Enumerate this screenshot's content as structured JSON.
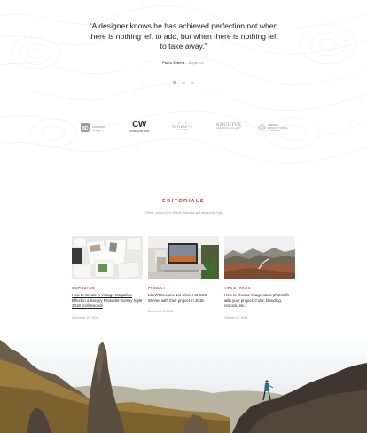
{
  "testimonial": {
    "quote": "“A designer knows he has achieved perfection not when there is nothing left to add, but when there is nothing left to take away.”",
    "author_name": "Paolo Sybera",
    "author_company": "Apple Inc.",
    "author_separator": "–",
    "slide_count": 3,
    "active_slide": 1
  },
  "logos": [
    {
      "name": "BD",
      "line1": "business",
      "line2": "design"
    },
    {
      "name": "christopher wills",
      "mark": "CW"
    },
    {
      "name": "SERENITY",
      "line2": "SUITES"
    },
    {
      "name": "ARCHIVE",
      "line2": "CREATIVE GALLERY"
    },
    {
      "name": "PREMIUM",
      "line2": "ARCHITECTURE & INTERIORS"
    }
  ],
  "editorials": {
    "title": "EDITORIALS",
    "subtitle": "Check out our best UI kits, tutorials and awesome Figs"
  },
  "cards": [
    {
      "category": "INSPIRATION",
      "title": "How to Create a Vintage Magazine Effect in a Sergey Prokudin-Gorsky Style 2018 professional",
      "date": "December 20, 2018"
    },
    {
      "category": "PRODUCT",
      "title": "LifeVR became 1st winner at CSS Winner with their project in 2018.",
      "date": "December 8, 2018"
    },
    {
      "category": "TIPS & TRICKS",
      "title": "How to choose image stock photos fit with your project. Color, blending, restock, etc.",
      "date": "October 12, 2018"
    }
  ],
  "colors": {
    "accent": "#c0392b",
    "dot_active": "#e7a2a2",
    "dot_inactive": "#cfcfcf"
  }
}
